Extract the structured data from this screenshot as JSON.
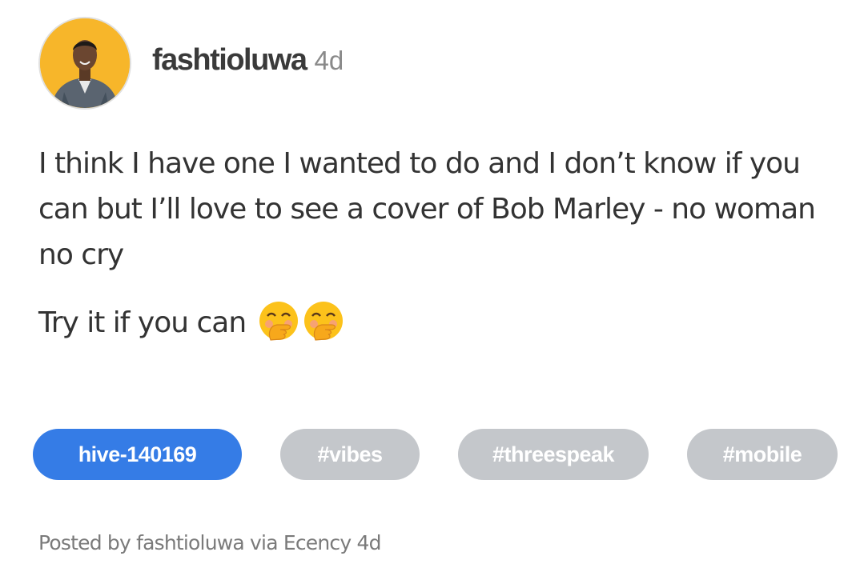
{
  "post": {
    "author": "fashtioluwa",
    "time": "4d",
    "paragraphs": [
      "I think I have one I wanted to do and I don’t know if you can but I’ll love to see a cover of Bob Marley - no woman no cry",
      "Try it if you can"
    ],
    "emoji_icons": [
      "hand-over-mouth-emoji-icon",
      "hand-over-mouth-emoji-icon"
    ]
  },
  "tags": [
    {
      "label": "hive-140169",
      "kind": "primary",
      "color": "#357ce6"
    },
    {
      "label": "#vibes",
      "kind": "secondary",
      "color": "#c4c7cb"
    },
    {
      "label": "#threespeak",
      "kind": "secondary",
      "color": "#c4c7cb"
    },
    {
      "label": "#mobile",
      "kind": "secondary",
      "color": "#c4c7cb"
    }
  ],
  "footer": {
    "text": "Posted by fashtioluwa via Ecency 4d"
  },
  "colors": {
    "avatar_bg": "#f7b62a",
    "text": "#333333",
    "muted": "#8a8a8a"
  }
}
